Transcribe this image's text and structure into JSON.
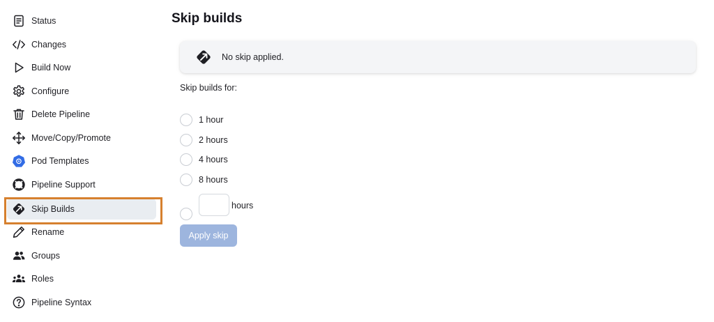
{
  "sidebar": {
    "items": [
      {
        "label": "Status",
        "icon": "document-icon"
      },
      {
        "label": "Changes",
        "icon": "code-icon"
      },
      {
        "label": "Build Now",
        "icon": "play-icon"
      },
      {
        "label": "Configure",
        "icon": "gear-icon"
      },
      {
        "label": "Delete Pipeline",
        "icon": "trash-icon"
      },
      {
        "label": "Move/Copy/Promote",
        "icon": "move-arrows-icon"
      },
      {
        "label": "Pod Templates",
        "icon": "kubernetes-icon"
      },
      {
        "label": "Pipeline Support",
        "icon": "lifebuoy-icon"
      },
      {
        "label": "Skip Builds",
        "icon": "skip-builds-icon",
        "active": true
      },
      {
        "label": "Rename",
        "icon": "pencil-icon"
      },
      {
        "label": "Groups",
        "icon": "group-icon"
      },
      {
        "label": "Roles",
        "icon": "roles-icon"
      },
      {
        "label": "Pipeline Syntax",
        "icon": "question-circle-icon"
      }
    ]
  },
  "main": {
    "title": "Skip builds",
    "notice": {
      "text": "No skip applied.",
      "icon": "skip-builds-icon"
    },
    "form": {
      "label": "Skip builds for:",
      "options": [
        "1 hour",
        "2 hours",
        "4 hours",
        "8 hours"
      ],
      "custom": {
        "value": "",
        "unit": "hours"
      },
      "apply_label": "Apply skip"
    }
  },
  "colors": {
    "highlight": "#d6802e",
    "active_bg": "#e9edf1",
    "apply_button": "#9db5de",
    "kubernetes": "#326ce5"
  }
}
